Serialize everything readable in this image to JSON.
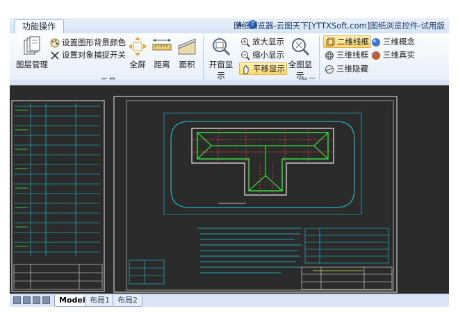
{
  "ribbon": {
    "tab_label": "功能操作",
    "title": "图纸浏览器-云图天下[YTTXSoft.com]图纸浏览控件-试用版",
    "groups": {
      "tools": "工具",
      "display": "显示"
    },
    "buttons": {
      "layer_manage": "图层管理",
      "set_bg_color": "设置图形背景颜色",
      "set_snap_toggle": "设置对象捕捉开关",
      "fullscreen": "全屏",
      "distance": "距离",
      "area": "面积",
      "window_display": "开窗显示",
      "zoom_in": "放大显示",
      "zoom_out": "缩小显示",
      "pan": "平移显示",
      "full_display": "全图显示",
      "wire_2d": "二维线框",
      "wire_3d": "三维线框",
      "hidden_3d": "三维隐藏",
      "concept_3d": "三维概念",
      "realistic_3d": "三维真实"
    }
  },
  "layout_tabs": [
    "Model",
    "布局1",
    "布局2"
  ],
  "active_layout": "Model",
  "colors": {
    "canvas_bg": "#2b2b2b",
    "cad_green": "#3cff3c",
    "cad_red": "#ff4040",
    "cad_cyan": "#19d3e6",
    "cad_white": "#e8e8e8",
    "cad_yellow": "#f2f24a"
  },
  "icons": [
    "layers-icon",
    "palette-icon",
    "snap-icon",
    "fullscreen-icon",
    "ruler-icon",
    "area-icon",
    "window-zoom-icon",
    "zoom-in-icon",
    "zoom-out-icon",
    "pan-icon",
    "zoom-extents-icon",
    "wireframe-2d-icon",
    "wireframe-3d-icon",
    "hidden-3d-icon",
    "conceptual-3d-icon",
    "realistic-3d-icon",
    "help-icon"
  ]
}
